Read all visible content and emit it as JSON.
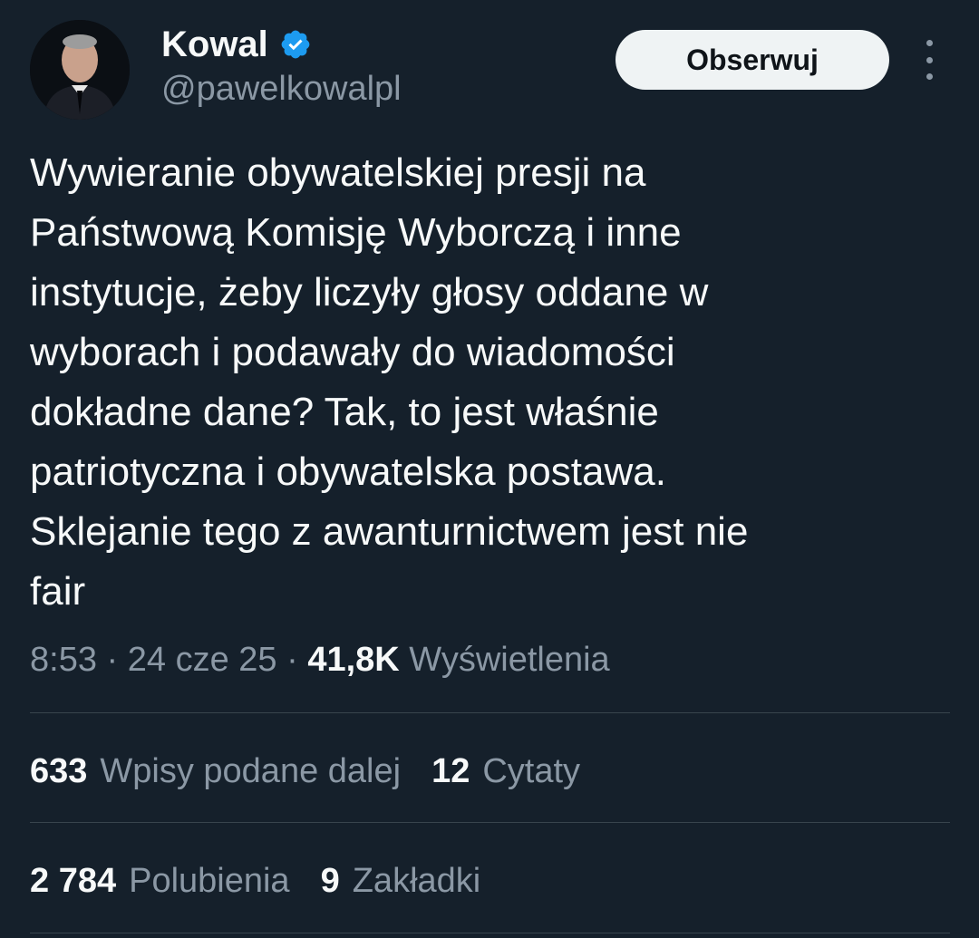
{
  "author": {
    "display_name": "Kowal",
    "handle": "@pawelkowalpl",
    "verified": true
  },
  "header": {
    "follow_label": "Obserwuj",
    "more_icon": "more-vertical-icon"
  },
  "tweet": {
    "text": "Wywieranie obywatelskiej presji na\nPaństwową Komisję Wyborczą i inne\ninstytucje, żeby liczyły głosy oddane w\nwyborach i podawały do wiadomości\ndokładne dane? Tak, to jest właśnie\npatriotyczna i obywatelska postawa.\nSklejanie tego z awanturnictwem jest nie\nfair"
  },
  "meta": {
    "time": "8:53",
    "separator": " · ",
    "date": "24 cze 25",
    "views_count": "41,8K",
    "views_label": "Wyświetlenia"
  },
  "stats": {
    "reposts_count": "633",
    "reposts_label": "Wpisy podane dalej",
    "quotes_count": "12",
    "quotes_label": "Cytaty",
    "likes_count": "2 784",
    "likes_label": "Polubienia",
    "bookmarks_count": "9",
    "bookmarks_label": "Zakładki"
  },
  "colors": {
    "background": "#15202b",
    "text_primary": "#f7f9f9",
    "text_secondary": "#8b98a5",
    "divider": "#38444d",
    "verified_badge": "#1d9bf0",
    "follow_button_bg": "#eff3f4"
  }
}
